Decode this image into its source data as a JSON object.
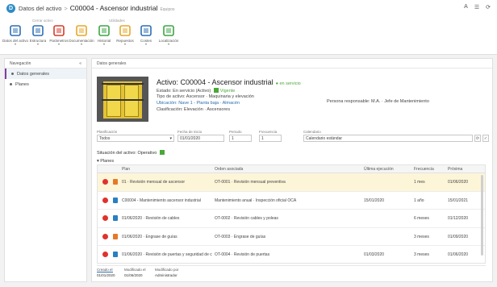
{
  "window": {
    "breadcrumb_root": "Datos del activo",
    "breadcrumb_sep": ">",
    "breadcrumb_current": "C00004 - Ascensor industrial",
    "breadcrumb_tag": "Equipos",
    "right_icons": [
      "help-icon",
      "menu-icon",
      "refresh-icon"
    ]
  },
  "ribbon": {
    "groups": [
      "Cerrar activo",
      "Utilidades"
    ],
    "buttons": [
      {
        "label": "Datos del activo",
        "icon": "datasheet-icon",
        "color": "#2d6fb5"
      },
      {
        "label": "Estructura",
        "icon": "structure-icon",
        "color": "#2d6fb5"
      },
      {
        "label": "Parámetros",
        "icon": "gauge-icon",
        "color": "#d83a2a"
      },
      {
        "label": "Documentación",
        "icon": "folder-icon",
        "color": "#e6a72a"
      },
      {
        "label": "Historial",
        "icon": "history-icon",
        "color": "#3da544"
      },
      {
        "label": "Repuestos",
        "icon": "parts-icon",
        "color": "#e6a72a"
      },
      {
        "label": "Costes",
        "icon": "shield-icon",
        "color": "#2d6fb5"
      },
      {
        "label": "Localización",
        "icon": "building-icon",
        "color": "#3da544"
      }
    ]
  },
  "left_panel": {
    "header": "Navegación",
    "close": "«",
    "items": [
      "Datos generales",
      "Planes"
    ]
  },
  "main": {
    "header": "Datos generales",
    "asset": {
      "code_title": "Activo: C00004 - Ascensor industrial",
      "state": "en servicio",
      "state_line": "Estado: En servicio (Activo)",
      "state_value": "Vigente",
      "type_line": "Tipo de activo: Ascensor · Maquinaria y elevación",
      "location_line": "Ubicación: Nave 1 - Planta baja · Almacén",
      "class_line": "Clasificación: Elevación · Ascensores",
      "responsible": "Persona responsable: M.A. · Jefe de Mantenimiento"
    },
    "filters": [
      {
        "label": "Planificación",
        "value": "Todos"
      },
      {
        "label": "Fecha de inicio",
        "value": "01/01/2020"
      },
      {
        "label": "Periodo",
        "value": "1"
      },
      {
        "label": "Frecuencia",
        "value": "1"
      },
      {
        "label": "Calendario",
        "value": "Calendario estándar"
      }
    ],
    "filter_buttons": [
      "⟳",
      "✓"
    ],
    "status": "Situación del activo: Operativo",
    "plans_label": "Planes",
    "table": {
      "headers": [
        "Plan",
        "Orden asociada",
        "Última ejecución",
        "Frecuencia",
        "Próxima"
      ],
      "rows": [
        {
          "plan": "01 · Revisión mensual de ascensor",
          "order": "OT-0001 · Revisión mensual preventiva",
          "last": "",
          "freq": "1 mes",
          "next": "01/06/2020",
          "type": "doc",
          "highlight": true
        },
        {
          "plan": "C00004 - Mantenimiento ascensor industrial",
          "order": "Mantenimiento anual · Inspección oficial OCA",
          "last": "15/01/2020",
          "freq": "1 año",
          "next": "15/01/2021",
          "type": "cal",
          "highlight": false
        },
        {
          "plan": "01/06/2020 · Revisión de cables",
          "order": "OT-0002 · Revisión cables y poleas",
          "last": "",
          "freq": "6 meses",
          "next": "01/12/2020",
          "type": "cal",
          "highlight": false
        },
        {
          "plan": "01/06/2020 · Engrase de guías",
          "order": "OT-0003 · Engrase de guías",
          "last": "",
          "freq": "3 meses",
          "next": "01/09/2020",
          "type": "doc",
          "highlight": false
        },
        {
          "plan": "01/06/2020 · Revisión de puertas y seguridad de cabina",
          "order": "OT-0004 · Revisión de puertas",
          "last": "01/03/2020",
          "freq": "3 meses",
          "next": "01/06/2020",
          "type": "cal",
          "highlight": false
        }
      ]
    },
    "footer": {
      "labels": [
        "Creado el",
        "Modificado el",
        "Modificado por"
      ],
      "values": [
        "01/01/2020",
        "01/06/2020",
        "Administrador"
      ]
    }
  },
  "colors": {
    "accent": "#7b3fa1",
    "ok": "#4aa838",
    "remove": "#e0322d",
    "highlight_row": "#fdf5d8"
  }
}
